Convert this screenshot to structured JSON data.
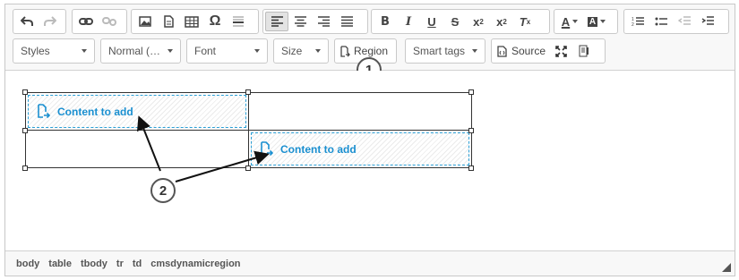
{
  "toolbar": {
    "styles_label": "Styles",
    "format_label": "Normal (…",
    "font_label": "Font",
    "size_label": "Size",
    "region_label": "Region",
    "smart_tags_label": "Smart tags",
    "source_label": "Source"
  },
  "content": {
    "region_1_label": "Content to add",
    "region_2_label": "Content to add"
  },
  "callouts": {
    "one": "1",
    "two": "2"
  },
  "status_bar": {
    "path": [
      "body",
      "table",
      "tbody",
      "tr",
      "td",
      "cmsdynamicregion"
    ]
  },
  "colors": {
    "region_accent": "#1a8fd0",
    "toolbar_bg": "#f8f8f8"
  }
}
